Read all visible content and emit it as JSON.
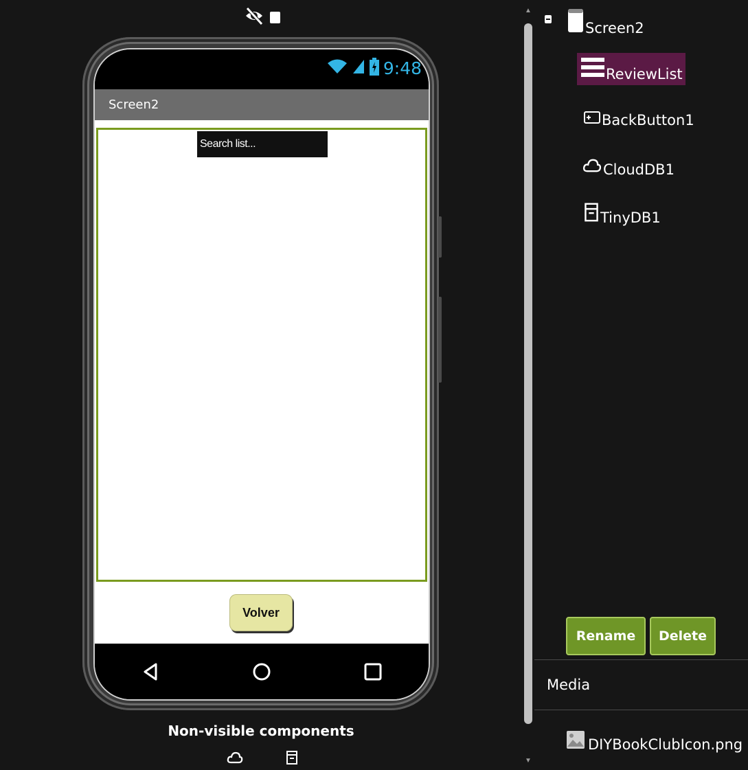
{
  "viewer": {
    "status_time": "9:48",
    "screen_title": "Screen2",
    "search_placeholder": "Search list...",
    "volver_label": "Volver",
    "nonvisible_label": "Non-visible components",
    "nonvisible_icons": [
      "cloud-icon",
      "archive-icon"
    ]
  },
  "components": {
    "root": "Screen2",
    "items": [
      {
        "label": "ReviewList",
        "icon": "list-icon",
        "selected": true
      },
      {
        "label": "BackButton1",
        "icon": "button-icon",
        "selected": false
      },
      {
        "label": "CloudDB1",
        "icon": "cloud-icon",
        "selected": false
      },
      {
        "label": "TinyDB1",
        "icon": "archive-icon",
        "selected": false
      }
    ],
    "rename_label": "Rename",
    "delete_label": "Delete"
  },
  "media": {
    "title": "Media",
    "files": [
      "DIYBookClubIcon.png"
    ]
  },
  "colors": {
    "accent_green": "#6f9627",
    "selected_bg": "#5b1a45",
    "list_border": "#7a9b1f",
    "button_yellow": "#e6e6a3",
    "status_blue": "#33b5e5"
  }
}
